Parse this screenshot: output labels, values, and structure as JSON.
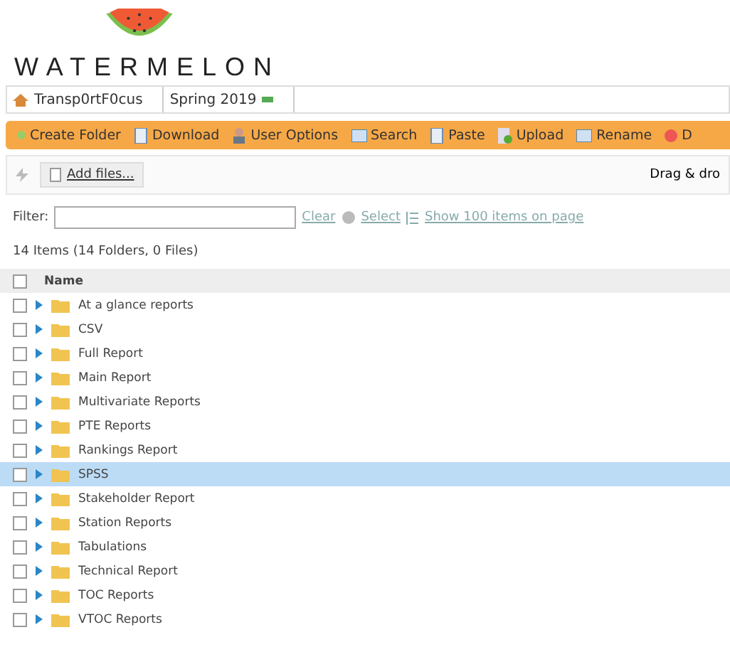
{
  "logo": {
    "text": "WATERMELON"
  },
  "breadcrumb": [
    {
      "label": "Transp0rtF0cus",
      "kind": "home"
    },
    {
      "label": "Spring 2019",
      "kind": "current"
    }
  ],
  "toolbar": [
    {
      "label": "Create Folder",
      "kind": "dot"
    },
    {
      "label": "Download",
      "kind": "doc"
    },
    {
      "label": "User Options",
      "kind": "user"
    },
    {
      "label": "Search",
      "kind": "window"
    },
    {
      "label": "Paste",
      "kind": "doc"
    },
    {
      "label": "Upload",
      "kind": "upload"
    },
    {
      "label": "Rename",
      "kind": "window"
    },
    {
      "label": "D",
      "kind": "delete"
    }
  ],
  "upload": {
    "button": "Add files...",
    "hint": "Drag & dro"
  },
  "filter": {
    "label": "Filter:",
    "clear": "Clear",
    "select": "Select",
    "show": "Show 100 items on page"
  },
  "summary": "14 Items (14 Folders, 0 Files)",
  "table": {
    "header": "Name",
    "header_checked": false,
    "rows": [
      {
        "name": "At a glance reports",
        "checked": false,
        "selected": false
      },
      {
        "name": "CSV",
        "checked": false,
        "selected": false
      },
      {
        "name": "Full Report",
        "checked": false,
        "selected": false
      },
      {
        "name": "Main Report",
        "checked": false,
        "selected": false
      },
      {
        "name": "Multivariate Reports",
        "checked": false,
        "selected": false
      },
      {
        "name": "PTE Reports",
        "checked": false,
        "selected": false
      },
      {
        "name": "Rankings Report",
        "checked": false,
        "selected": false
      },
      {
        "name": "SPSS",
        "checked": false,
        "selected": true
      },
      {
        "name": "Stakeholder Report",
        "checked": false,
        "selected": false
      },
      {
        "name": "Station Reports",
        "checked": false,
        "selected": false
      },
      {
        "name": "Tabulations",
        "checked": false,
        "selected": false
      },
      {
        "name": "Technical Report",
        "checked": false,
        "selected": false
      },
      {
        "name": "TOC Reports",
        "checked": false,
        "selected": false
      },
      {
        "name": "VTOC Reports",
        "checked": false,
        "selected": false
      }
    ]
  }
}
